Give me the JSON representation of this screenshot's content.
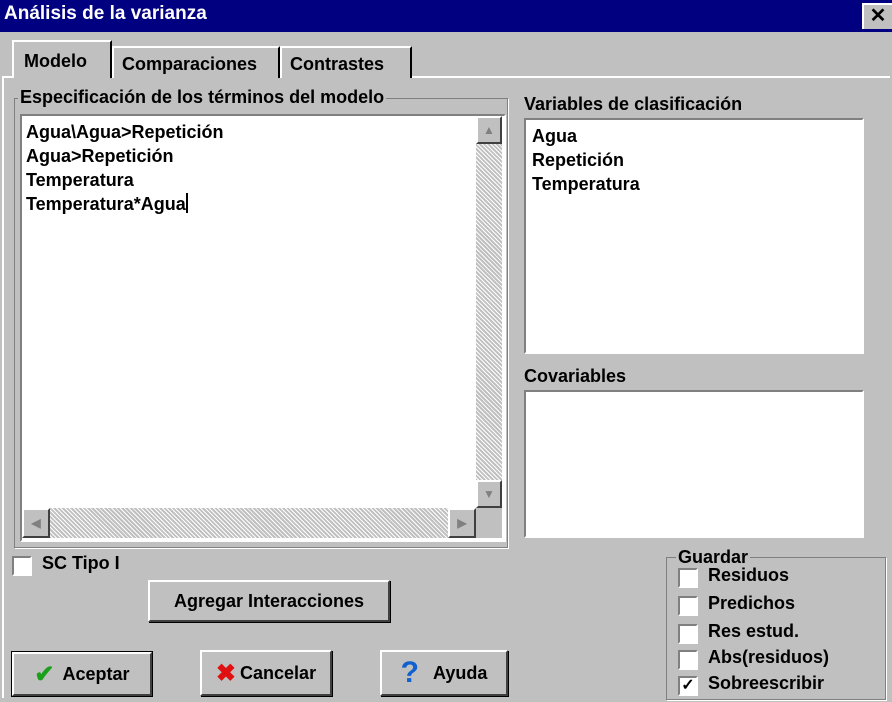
{
  "window": {
    "title": "Análisis de la varianza",
    "close_glyph": "✕"
  },
  "tabs": [
    {
      "label": "Modelo",
      "active": true
    },
    {
      "label": "Comparaciones",
      "active": false
    },
    {
      "label": "Contrastes",
      "active": false
    }
  ],
  "model_spec": {
    "label": "Especificación de los términos del modelo",
    "lines": [
      "Agua\\Agua>Repetición",
      "Agua>Repetición",
      "Temperatura",
      "Temperatura*Agua"
    ]
  },
  "classification": {
    "label": "Variables de clasificación",
    "items": [
      "Agua",
      "Repetición",
      "Temperatura"
    ]
  },
  "covariables": {
    "label": "Covariables",
    "items": []
  },
  "sc_tipo": {
    "label": "SC Tipo I",
    "checked": false
  },
  "buttons": {
    "agregar": "Agregar Interacciones",
    "aceptar": "Aceptar",
    "cancelar": "Cancelar",
    "ayuda": "Ayuda"
  },
  "guardar": {
    "label": "Guardar",
    "options": [
      {
        "label": "Residuos",
        "checked": false
      },
      {
        "label": "Predichos",
        "checked": false
      },
      {
        "label": "Res estud.",
        "checked": false
      },
      {
        "label": "Abs(residuos)",
        "checked": false
      },
      {
        "label": "Sobreescribir",
        "checked": true
      }
    ]
  },
  "colors": {
    "titlebar": "#000080",
    "face": "#c0c0c0",
    "accept_icon": "#1aa01a",
    "cancel_icon": "#e01010",
    "help_icon": "#1060d0"
  },
  "icons": {
    "aceptar": "check-icon",
    "cancelar": "x-icon",
    "ayuda": "question-icon"
  }
}
